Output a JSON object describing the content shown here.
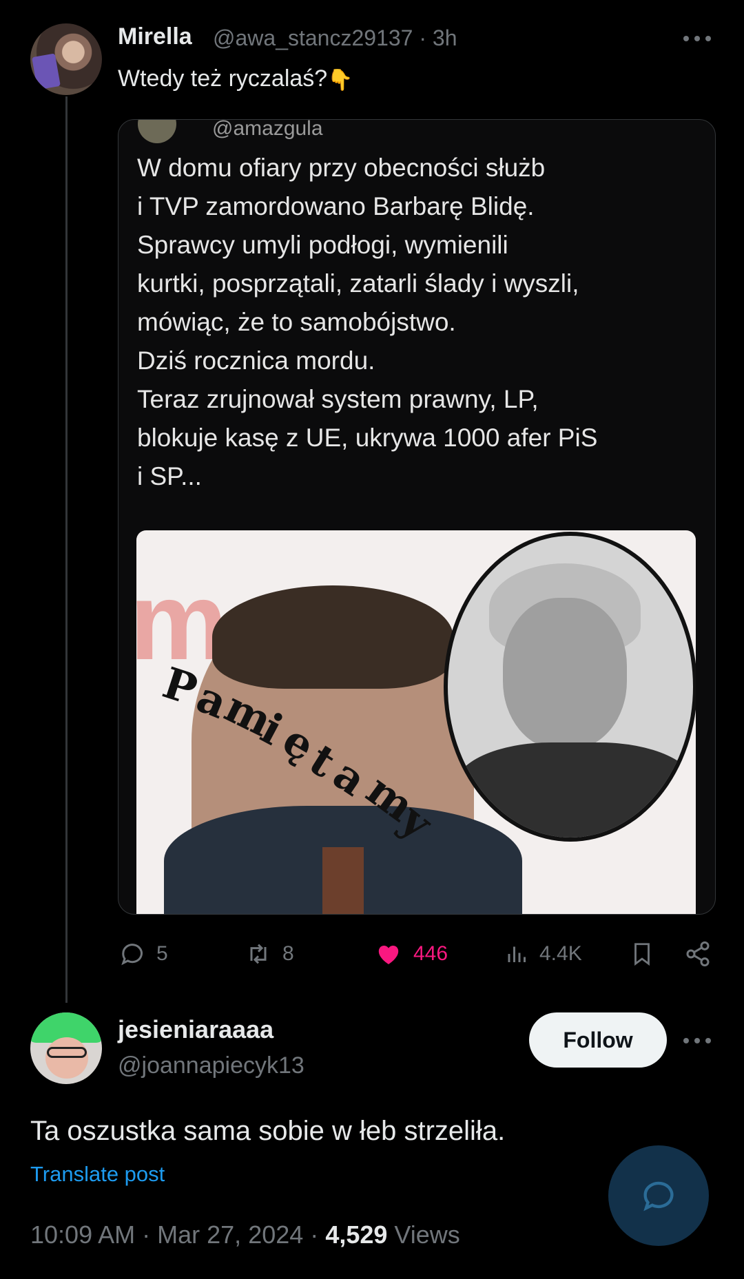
{
  "tweet": {
    "author_name": "Mirella",
    "author_handle": "@awa_stancz29137",
    "separator": "·",
    "time_ago": "3h",
    "text": "Wtedy też ryczalaś?",
    "emoji": "👇",
    "quote": {
      "handle": "@amazgula",
      "text": "W domu ofiary przy obecności służb\ni TVP zamordowano Barbarę Blidę.\nSprawcy umyli podłogi, wymienili\nkurtki, posprzątali, zatarli ślady i wyszli,\nmówiąc, że to samobójstwo.\nDziś rocznica mordu.\nTeraz zrujnował system prawny, LP,\nblokuje kasę z UE, ukrywa 1000 afer PiS\ni SP...",
      "image_watermark_letters": [
        "P",
        "a",
        "m",
        "i",
        "ę",
        "t",
        "a",
        "m",
        "y"
      ]
    },
    "actions": {
      "replies": "5",
      "reposts": "8",
      "likes": "446",
      "views": "4.4K"
    }
  },
  "reply": {
    "author_name": "jesieniaraaaa",
    "author_handle": "@joannapiecyk13",
    "follow_label": "Follow",
    "text": "Ta oszustka sama sobie w łeb strzeliła.",
    "translate_label": "Translate post",
    "time": "10:09 AM",
    "date": "Mar 27, 2024",
    "views_count": "4,529",
    "views_label": "Views"
  },
  "colors": {
    "background": "#000000",
    "text": "#e7e9ea",
    "muted": "#71767b",
    "link": "#1d9bf0",
    "like": "#f91880"
  },
  "icons": [
    "more-icon",
    "reply-icon",
    "repost-icon",
    "like-icon",
    "views-icon",
    "bookmark-icon",
    "share-icon",
    "compose-reply-icon"
  ]
}
